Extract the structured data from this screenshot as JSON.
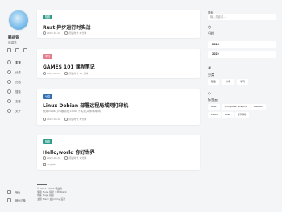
{
  "profile": {
    "name": "韩益锐",
    "subtitle": "前端笔"
  },
  "nav": {
    "items": [
      {
        "label": "主页"
      },
      {
        "label": "分类"
      },
      {
        "label": "归档"
      },
      {
        "label": "搜索"
      },
      {
        "label": "友链"
      },
      {
        "label": "关于"
      }
    ]
  },
  "sidebar_bottom": {
    "theme": "暗色",
    "rss": "暗色切换"
  },
  "posts": [
    {
      "badge": "随笔",
      "badge_color": "#2e9c8a",
      "title": "Rust 异步运行时实战",
      "date": "2022-01-01",
      "read": "阅读时长 4 分钟"
    },
    {
      "badge": "学习",
      "badge_color": "#e57a8a",
      "title": "GAMES 101 课程笔记",
      "date": "2022-04-01",
      "read": "阅读时长 12 分钟"
    },
    {
      "badge": "分享",
      "badge_color": "#2f6fb2",
      "title": "Linux Debian 部署远程局域网打印机",
      "desc": "使用cups打印服务在Linux下实现共享局域网",
      "date": "2022-03-04",
      "read": "阅读时长 3 分钟"
    },
    {
      "badge": "随笔",
      "badge_color": "#2e9c8a",
      "title": "Hello,world 你好世界",
      "date": "2022-02-01",
      "read": "阅读时长 1 分钟",
      "tag": "English"
    }
  ],
  "footer": {
    "lines": [
      "© 2022 - 2023 韩益锐",
      "使用 Hugo 搭建 主题 Stack",
      "博客 Hugo 搭建",
      "主题 Stack 由 Jimmy 设计"
    ]
  },
  "widgets": {
    "search": {
      "label": "搜索",
      "placeholder": "输入关键词..."
    },
    "archive": {
      "title": "归档",
      "icon": "#",
      "years": [
        "2024",
        "2022"
      ]
    },
    "categories": {
      "title": "分类",
      "icon": "#",
      "items": [
        "随笔",
        "分享",
        "学习"
      ]
    },
    "tags": {
      "title": "标签云",
      "items": [
        "Rust",
        "Computer Graphic",
        "Debian",
        "Linux",
        "Rust",
        "打印机"
      ]
    }
  }
}
